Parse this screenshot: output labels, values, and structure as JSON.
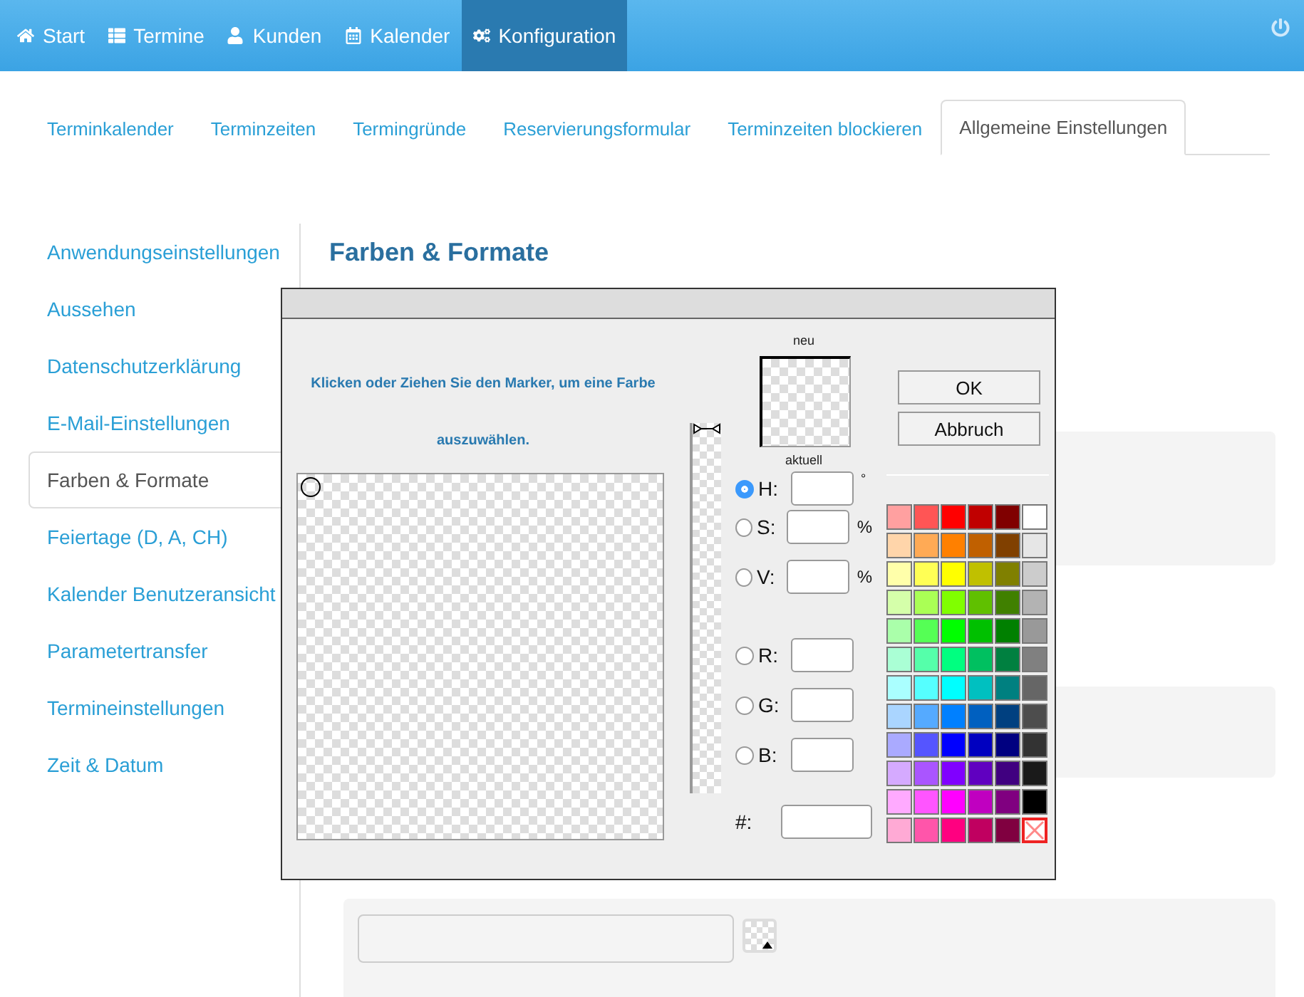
{
  "navbar": {
    "items": [
      {
        "label": "Start",
        "selected": false
      },
      {
        "label": "Termine",
        "selected": false
      },
      {
        "label": "Kunden",
        "selected": false
      },
      {
        "label": "Kalender",
        "selected": false
      },
      {
        "label": "Konfiguration",
        "selected": true
      }
    ]
  },
  "tabs": [
    {
      "label": "Terminkalender",
      "selected": false
    },
    {
      "label": "Terminzeiten",
      "selected": false
    },
    {
      "label": "Termingründe",
      "selected": false
    },
    {
      "label": "Reservierungsformular",
      "selected": false
    },
    {
      "label": "Terminzeiten blockieren",
      "selected": false
    },
    {
      "label": "Allgemeine Einstellungen",
      "selected": true
    }
  ],
  "sidebar": {
    "items": [
      {
        "label": "Anwendungseinstellungen",
        "selected": false
      },
      {
        "label": "Aussehen",
        "selected": false
      },
      {
        "label": "Datenschutzerklärung",
        "selected": false
      },
      {
        "label": "E-Mail-Einstellungen",
        "selected": false
      },
      {
        "label": "Farben & Formate",
        "selected": true
      },
      {
        "label": "Feiertage (D, A, CH)",
        "selected": false
      },
      {
        "label": "Kalender Benutzeransicht",
        "selected": false
      },
      {
        "label": "Parametertransfer",
        "selected": false
      },
      {
        "label": "Termineinstellungen",
        "selected": false
      },
      {
        "label": "Zeit & Datum",
        "selected": false
      }
    ]
  },
  "section_title": "Farben & Formate",
  "color_picker": {
    "instruction": "Klicken oder Ziehen Sie den Marker, um eine Farbe auszuwählen.",
    "hue_slider": {
      "level": 0
    },
    "new_label": "neu",
    "current_label": "aktuell",
    "fields": [
      {
        "kind": "radio",
        "label": "H:",
        "unit": "°",
        "selected": true
      },
      {
        "kind": "radio",
        "label": "S:",
        "unit": "%",
        "selected": false
      },
      {
        "kind": "radio",
        "label": "V:",
        "unit": "%",
        "selected": false
      },
      {
        "kind": "radio",
        "label": "R:",
        "selected": false
      },
      {
        "kind": "radio",
        "label": "G:",
        "selected": false
      },
      {
        "kind": "radio",
        "label": "B:",
        "selected": false
      },
      {
        "kind": "hex",
        "label": "#:"
      }
    ],
    "buttons": [
      "OK",
      "Abbruch"
    ],
    "swatches": [
      {
        "kind": "color",
        "color": "#ffa0a0"
      },
      {
        "kind": "color",
        "color": "#ff5555"
      },
      {
        "kind": "color",
        "color": "#ff0000"
      },
      {
        "kind": "color",
        "color": "#c00000"
      },
      {
        "kind": "color",
        "color": "#800000"
      },
      {
        "kind": "color",
        "color": "#ffffff"
      },
      {
        "kind": "color",
        "color": "#ffd5aa"
      },
      {
        "kind": "color",
        "color": "#ffaa55"
      },
      {
        "kind": "color",
        "color": "#ff8000"
      },
      {
        "kind": "color",
        "color": "#c06000"
      },
      {
        "kind": "color",
        "color": "#804000"
      },
      {
        "kind": "color",
        "color": "#e6e6e6"
      },
      {
        "kind": "color",
        "color": "#ffffaa"
      },
      {
        "kind": "color",
        "color": "#ffff55"
      },
      {
        "kind": "color",
        "color": "#ffff00"
      },
      {
        "kind": "color",
        "color": "#c0c000"
      },
      {
        "kind": "color",
        "color": "#808000"
      },
      {
        "kind": "color",
        "color": "#cccccc"
      },
      {
        "kind": "color",
        "color": "#d5ffaa"
      },
      {
        "kind": "color",
        "color": "#aaff55"
      },
      {
        "kind": "color",
        "color": "#80ff00"
      },
      {
        "kind": "color",
        "color": "#60c000"
      },
      {
        "kind": "color",
        "color": "#408000"
      },
      {
        "kind": "color",
        "color": "#b3b3b3"
      },
      {
        "kind": "color",
        "color": "#aaffaa"
      },
      {
        "kind": "color",
        "color": "#55ff55"
      },
      {
        "kind": "color",
        "color": "#00ff00"
      },
      {
        "kind": "color",
        "color": "#00c000"
      },
      {
        "kind": "color",
        "color": "#008000"
      },
      {
        "kind": "color",
        "color": "#999999"
      },
      {
        "kind": "color",
        "color": "#aaffd5"
      },
      {
        "kind": "color",
        "color": "#55ffaa"
      },
      {
        "kind": "color",
        "color": "#00ff80"
      },
      {
        "kind": "color",
        "color": "#00c060"
      },
      {
        "kind": "color",
        "color": "#008040"
      },
      {
        "kind": "color",
        "color": "#808080"
      },
      {
        "kind": "color",
        "color": "#aaffff"
      },
      {
        "kind": "color",
        "color": "#55ffff"
      },
      {
        "kind": "color",
        "color": "#00ffff"
      },
      {
        "kind": "color",
        "color": "#00c0c0"
      },
      {
        "kind": "color",
        "color": "#008080"
      },
      {
        "kind": "color",
        "color": "#666666"
      },
      {
        "kind": "color",
        "color": "#aad5ff"
      },
      {
        "kind": "color",
        "color": "#55aaff"
      },
      {
        "kind": "color",
        "color": "#0080ff"
      },
      {
        "kind": "color",
        "color": "#0060c0"
      },
      {
        "kind": "color",
        "color": "#004080"
      },
      {
        "kind": "color",
        "color": "#4d4d4d"
      },
      {
        "kind": "color",
        "color": "#aaaaff"
      },
      {
        "kind": "color",
        "color": "#5555ff"
      },
      {
        "kind": "color",
        "color": "#0000ff"
      },
      {
        "kind": "color",
        "color": "#0000c0"
      },
      {
        "kind": "color",
        "color": "#000080"
      },
      {
        "kind": "color",
        "color": "#333333"
      },
      {
        "kind": "color",
        "color": "#d5aaff"
      },
      {
        "kind": "color",
        "color": "#aa55ff"
      },
      {
        "kind": "color",
        "color": "#8000ff"
      },
      {
        "kind": "color",
        "color": "#6000c0"
      },
      {
        "kind": "color",
        "color": "#400080"
      },
      {
        "kind": "color",
        "color": "#1a1a1a"
      },
      {
        "kind": "color",
        "color": "#ffaaff"
      },
      {
        "kind": "color",
        "color": "#ff55ff"
      },
      {
        "kind": "color",
        "color": "#ff00ff"
      },
      {
        "kind": "color",
        "color": "#c000c0"
      },
      {
        "kind": "color",
        "color": "#800080"
      },
      {
        "kind": "color",
        "color": "#000000"
      },
      {
        "kind": "color",
        "color": "#ffaad5"
      },
      {
        "kind": "color",
        "color": "#ff55aa"
      },
      {
        "kind": "color",
        "color": "#ff0080"
      },
      {
        "kind": "color",
        "color": "#c00060"
      },
      {
        "kind": "color",
        "color": "#800040"
      },
      {
        "kind": "none"
      }
    ]
  }
}
